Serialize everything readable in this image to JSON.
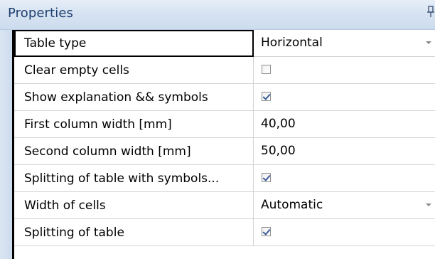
{
  "panel": {
    "title": "Properties",
    "pin_icon": "pin-icon"
  },
  "rows": [
    {
      "label": "Table type",
      "value_type": "dropdown",
      "value": "Horizontal",
      "selected": true
    },
    {
      "label": "Clear empty cells",
      "value_type": "checkbox",
      "checked": false
    },
    {
      "label": "Show explanation && symbols",
      "value_type": "checkbox",
      "checked": true
    },
    {
      "label": "First column width [mm]",
      "value_type": "text",
      "value": "40,00"
    },
    {
      "label": "Second column width [mm]",
      "value_type": "text",
      "value": "50,00"
    },
    {
      "label": "Splitting of table with symbols...",
      "value_type": "checkbox",
      "checked": true
    },
    {
      "label": "Width of cells",
      "value_type": "dropdown",
      "value": "Automatic"
    },
    {
      "label": "Splitting of table",
      "value_type": "checkbox",
      "checked": true
    }
  ],
  "colors": {
    "title_text": "#1e3f6f",
    "header_bg": "#d7e3f2",
    "grid_line": "#d3d3d3",
    "check_mark": "#3a5a9a"
  }
}
